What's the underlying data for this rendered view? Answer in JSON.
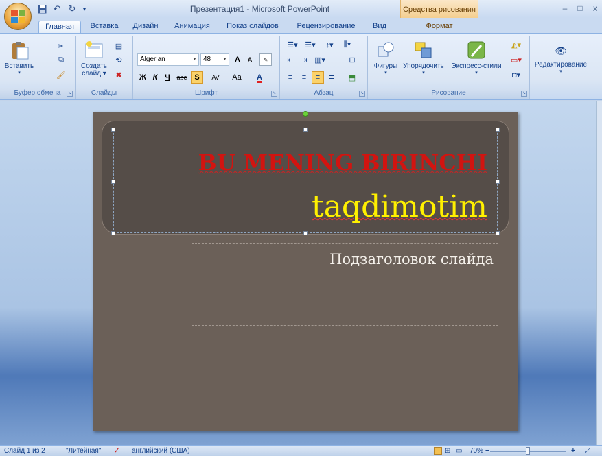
{
  "window": {
    "title": "Презентация1 - Microsoft PowerPoint",
    "contextual_tools": "Средства рисования",
    "min": "–",
    "max": "□",
    "close": "x"
  },
  "quick_access": {
    "save_icon": "save-icon",
    "undo_icon": "undo-icon",
    "redo_icon": "redo-icon",
    "customize": "▾"
  },
  "tabs": [
    "Главная",
    "Вставка",
    "Дизайн",
    "Анимация",
    "Показ слайдов",
    "Рецензирование",
    "Вид",
    "Формат"
  ],
  "active_tab": "Главная",
  "groups": {
    "clipboard": {
      "label": "Буфер обмена",
      "paste": "Вставить"
    },
    "slides": {
      "label": "Слайды",
      "new_slide_1": "Создать",
      "new_slide_2": "слайд ▾"
    },
    "font": {
      "label": "Шрифт",
      "font_name": "Algerian",
      "font_size": "48",
      "grow": "A",
      "shrink": "A",
      "bold": "Ж",
      "italic": "К",
      "underline": "Ч",
      "strike": "abe",
      "shadow": "S",
      "spacing": "AV",
      "case": "Aa",
      "color": "A"
    },
    "paragraph": {
      "label": "Абзац"
    },
    "drawing": {
      "label": "Рисование",
      "shapes": "Фигуры",
      "arrange": "Упорядочить",
      "quick_styles": "Экспресс-стили"
    },
    "editing": {
      "label": "Редактирование",
      "find": "Редактирование"
    }
  },
  "slide": {
    "title_line1": "BU MENING BIRINCHI",
    "title_line2": "taqdimotim",
    "subtitle_placeholder": "Подзаголовок слайда"
  },
  "status": {
    "slide_of": "Слайд 1 из 2",
    "theme": "\"Литейная\"",
    "language": "английский (США)",
    "zoom": "70%",
    "zoom_out": "−",
    "zoom_in": "+"
  },
  "colors": {
    "slide_bg": "#6b6058",
    "title_band": "#554d48",
    "title_red": "#d21410",
    "title_yellow": "#fff000",
    "ribbon": "#dbe6f4"
  }
}
